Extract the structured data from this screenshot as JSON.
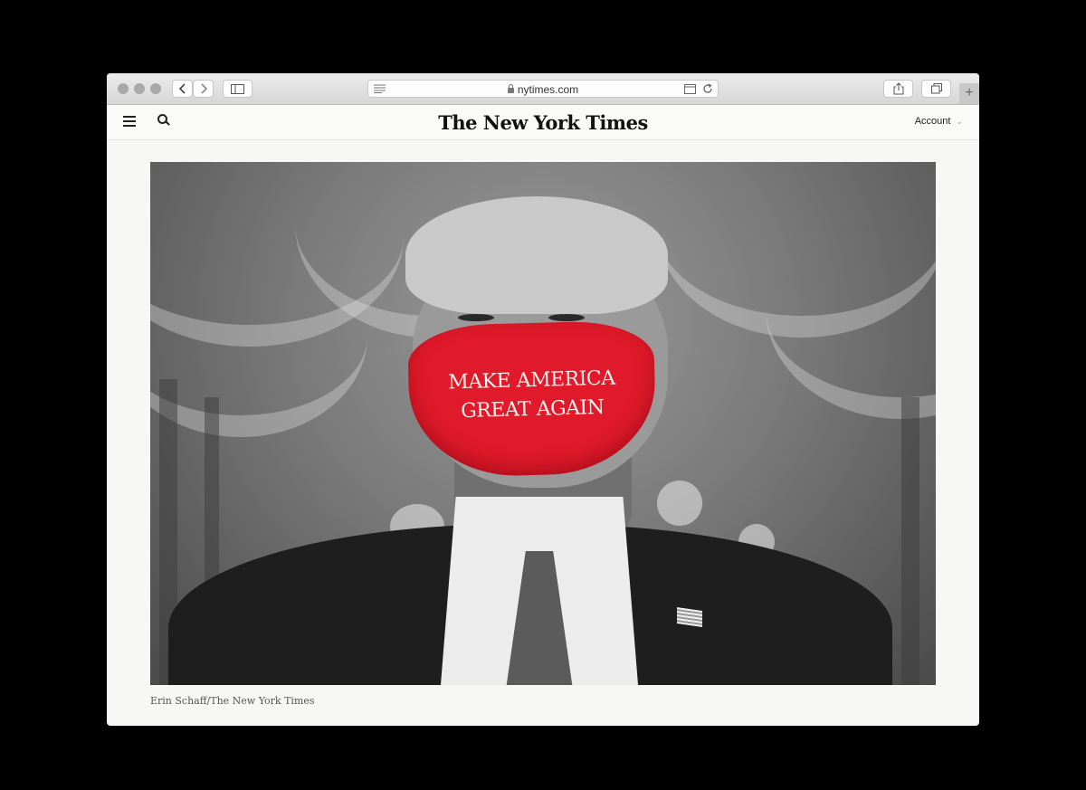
{
  "browser": {
    "url": "nytimes.com",
    "icons": {
      "back": "chevron-left-icon",
      "forward": "chevron-right-icon",
      "sidebar": "sidebar-icon",
      "reader": "reader-icon",
      "reload": "reload-icon",
      "share": "share-icon",
      "tabs": "tabs-icon",
      "new_tab": "plus-icon"
    }
  },
  "site": {
    "masthead": "The New York Times",
    "account_label": "Account"
  },
  "article": {
    "mask_text_line1": "MAKE AMERICA",
    "mask_text_line2": "GREAT AGAIN",
    "photo_credit": "Erin Schaff/The New York Times"
  },
  "colors": {
    "mask_red": "#e01a2b",
    "page_background": "#000000"
  }
}
